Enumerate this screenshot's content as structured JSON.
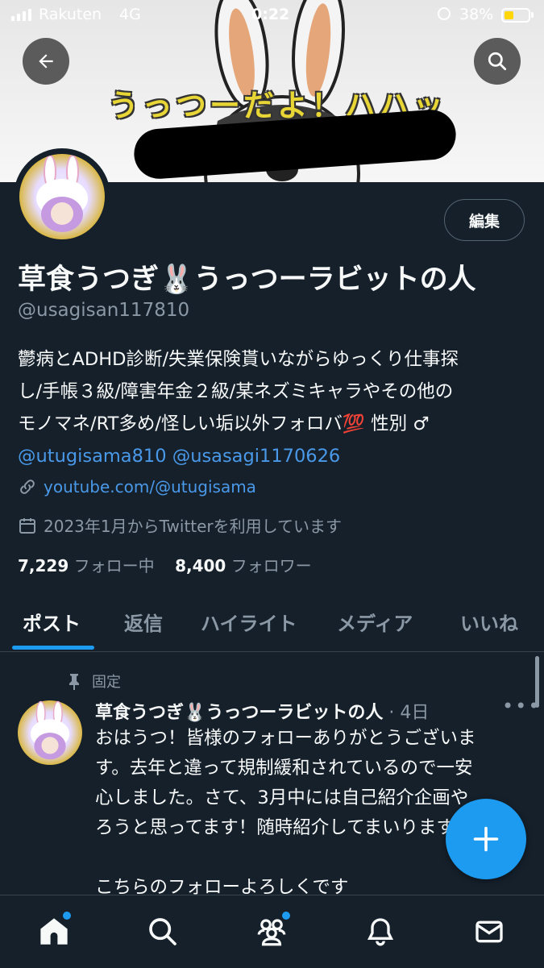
{
  "status_bar": {
    "carrier": "Rakuten",
    "network": "4G",
    "time": "0:22",
    "battery": "38%",
    "battery_level": 0.38
  },
  "header": {
    "banner_text": "うっつーだよ！ハハッ",
    "back_icon": "arrow-left-icon",
    "search_icon": "search-icon"
  },
  "profile": {
    "edit_label": "編集",
    "display_name": "草食うつぎ🐰うっつーラビットの人",
    "handle": "@usagisan117810",
    "bio_lines": [
      "鬱病とADHD診断/失業保険貰いながらゆっくり仕事探",
      "し/手帳３級/障害年金２級/某ネズミキャラやその他の",
      "モノマネ/RT多め/怪しい垢以外フォロバ💯 性別 ♂"
    ],
    "bio_mentions": "@utugisama810 @usasagi1170626",
    "website": "youtube.com/@utugisama",
    "joined": "2023年1月からTwitterを利用しています",
    "following_count": "7,229",
    "following_label": "フォロー中",
    "followers_count": "8,400",
    "followers_label": "フォロワー"
  },
  "tabs": [
    "ポスト",
    "返信",
    "ハイライト",
    "メディア",
    "いいね"
  ],
  "active_tab": 0,
  "pinned_post": {
    "pinned_label": "固定",
    "author": "草食うつぎ🐰うっつーラビットの人",
    "time": "· 4日",
    "text_lines": [
      "おはうつ！皆様のフォローありがとうございま",
      "す。去年と違って規制緩和されているので一安",
      "心しました。さて、3月中には自己紹介企画や",
      "ろうと思ってます！随時紹介してまいります",
      "",
      "こちらのフォローよろしくです"
    ]
  },
  "bottom_nav": [
    "home-icon",
    "search-icon",
    "communities-icon",
    "notifications-icon",
    "messages-icon"
  ]
}
